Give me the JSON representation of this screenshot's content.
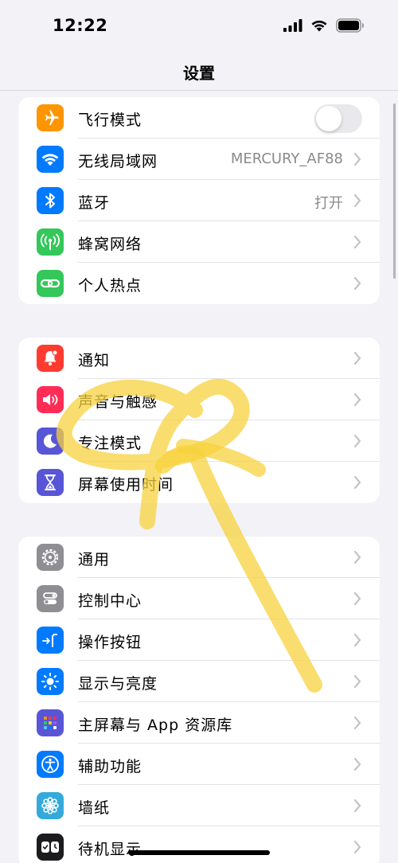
{
  "status_bar": {
    "time": "12:22"
  },
  "nav": {
    "title": "设置"
  },
  "groups": [
    {
      "rows": [
        {
          "label": "飞行模式",
          "icon": "airplane-icon",
          "color": "#ff9500",
          "control": "toggle",
          "toggle_on": false
        },
        {
          "label": "无线局域网",
          "icon": "wifi-icon",
          "color": "#007aff",
          "value": "MERCURY_AF88"
        },
        {
          "label": "蓝牙",
          "icon": "bluetooth-icon",
          "color": "#007aff",
          "value": "打开"
        },
        {
          "label": "蜂窝网络",
          "icon": "cellular-icon",
          "color": "#34c759"
        },
        {
          "label": "个人热点",
          "icon": "hotspot-icon",
          "color": "#34c759"
        }
      ]
    },
    {
      "rows": [
        {
          "label": "通知",
          "icon": "notification-bell-icon",
          "color": "#ff3b30"
        },
        {
          "label": "声音与触感",
          "icon": "speaker-icon",
          "color": "#ff2d55"
        },
        {
          "label": "专注模式",
          "icon": "moon-icon",
          "color": "#5856d6"
        },
        {
          "label": "屏幕使用时间",
          "icon": "hourglass-icon",
          "color": "#5856d6"
        }
      ]
    },
    {
      "rows": [
        {
          "label": "通用",
          "icon": "gear-icon",
          "color": "#8e8e93"
        },
        {
          "label": "控制中心",
          "icon": "switches-icon",
          "color": "#8e8e93"
        },
        {
          "label": "操作按钮",
          "icon": "action-button-icon",
          "color": "#007aff"
        },
        {
          "label": "显示与亮度",
          "icon": "sun-icon",
          "color": "#007aff"
        },
        {
          "label": "主屏幕与 App 资源库",
          "icon": "app-grid-icon",
          "color": "#5856d6"
        },
        {
          "label": "辅助功能",
          "icon": "accessibility-icon",
          "color": "#007aff"
        },
        {
          "label": "墙纸",
          "icon": "flower-icon",
          "color": "#34aadc"
        },
        {
          "label": "待机显示",
          "icon": "standby-icon",
          "color": "#1c1c1e"
        }
      ]
    }
  ]
}
